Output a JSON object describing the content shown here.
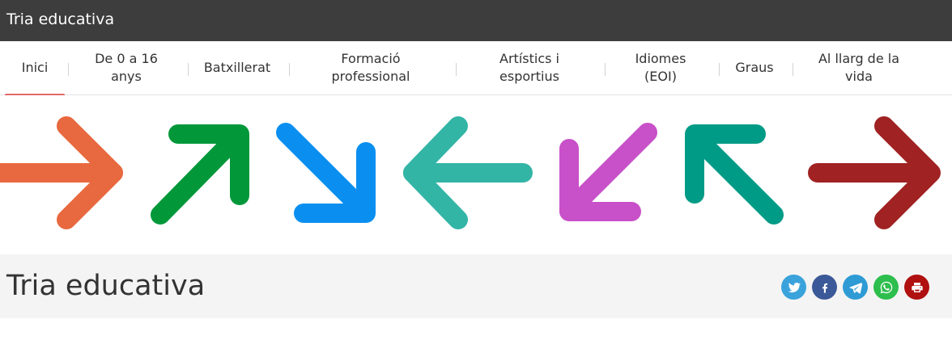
{
  "app": {
    "title": "Tria educativa"
  },
  "nav": {
    "items": [
      {
        "id": "inici",
        "label": "Inici",
        "active": true
      },
      {
        "id": "de-0-a-16-anys",
        "label": "De 0 a 16\nanys"
      },
      {
        "id": "batxillerat",
        "label": "Batxillerat"
      },
      {
        "id": "formacio-professional",
        "label": "Formació\nprofessional"
      },
      {
        "id": "artistics-i-esportius",
        "label": "Artístics i\nesportius"
      },
      {
        "id": "idiomes-eoi",
        "label": "Idiomes\n(EOI)"
      },
      {
        "id": "graus",
        "label": "Graus"
      },
      {
        "id": "al-llarg-de-la-vida",
        "label": "Al llarg de la\nvida"
      }
    ],
    "active_color": "#e06a6a"
  },
  "banner": {
    "arrows": [
      {
        "icon": "arrow-right-icon",
        "color": "#e8693f"
      },
      {
        "icon": "arrow-up-right-icon",
        "color": "#02983a"
      },
      {
        "icon": "arrow-down-right-icon",
        "color": "#0a8ff0"
      },
      {
        "icon": "arrow-left-icon",
        "color": "#33b5a6"
      },
      {
        "icon": "arrow-down-left-icon",
        "color": "#c850c8"
      },
      {
        "icon": "arrow-up-left-icon",
        "color": "#009b86"
      },
      {
        "icon": "arrow-right-icon",
        "color": "#a02222"
      }
    ]
  },
  "header": {
    "title": "Tria educativa",
    "share": [
      {
        "icon": "twitter-icon",
        "color": "#3aa3dc"
      },
      {
        "icon": "facebook-icon",
        "color": "#3b5998"
      },
      {
        "icon": "telegram-icon",
        "color": "#2f9bd5"
      },
      {
        "icon": "whatsapp-icon",
        "color": "#2dbe4d"
      },
      {
        "icon": "print-icon",
        "color": "#b01010"
      }
    ]
  }
}
